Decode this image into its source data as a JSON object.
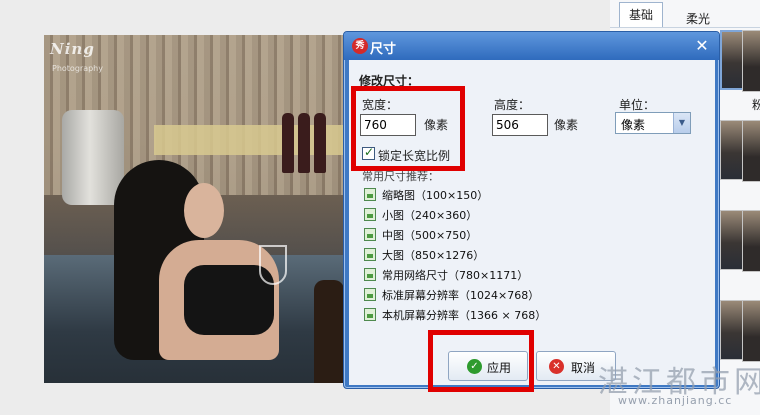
{
  "photo": {
    "logo_text": "Ning",
    "logo_subtext": "Photography"
  },
  "right_panel": {
    "tab_label": "基础",
    "filter_labels": [
      "柔光",
      "粉"
    ]
  },
  "dialog": {
    "app_logo_text": "秀",
    "title": "尺寸",
    "close_glyph": "✕",
    "section_title": "修改尺寸：",
    "width_label": "宽度：",
    "width_value": "760",
    "width_unit": "像素",
    "height_label": "高度：",
    "height_value": "506",
    "height_unit": "像素",
    "unit_label": "单位：",
    "unit_selected": "像素",
    "lock_ratio_checked": true,
    "lock_ratio_label": "锁定长宽比例",
    "presets_title": "常用尺寸推荐：",
    "presets": [
      "缩略图（100×150）",
      "小图（240×360）",
      "中图（500×750）",
      "大图（850×1276）",
      "常用网络尺寸（780×1171）",
      "标准屏幕分辨率（1024×768）",
      "本机屏幕分辨率（1366 × 768）"
    ],
    "apply_label": "应用",
    "cancel_label": "取消"
  },
  "colors": {
    "title_bar": "#2f6bbd",
    "highlight": "#e00000",
    "apply_icon": "#2e9b2e",
    "cancel_icon": "#d9312b"
  },
  "watermark": {
    "text": "湛江都市网",
    "url": "www.zhanjiang.cc"
  }
}
